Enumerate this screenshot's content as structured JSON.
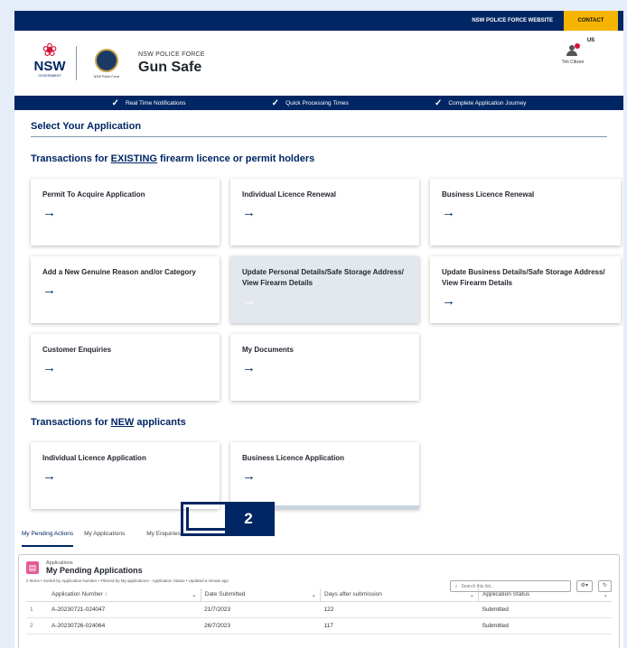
{
  "util_bar": {
    "website_link": "NSW POLICE FORCE WEBSITE",
    "contact": "CONTACT US"
  },
  "header": {
    "nsw_logo": {
      "word": "NSW",
      "sub": "GOVERNMENT"
    },
    "badge_label": "NSW Police Force",
    "org": "NSW POLICE FORCE",
    "app": "Gun Safe",
    "user_name": "Tim Citizen"
  },
  "features": [
    "Real Time Notifications",
    "Quick Processing Times",
    "Complete Application Journey"
  ],
  "page": {
    "title": "Select Your  Application",
    "existing": {
      "pre": "Transactions for ",
      "u": "EXISTING",
      "post": " firearm licence or permit holders"
    },
    "new": {
      "pre": "Transactions for ",
      "u": "NEW",
      "post": " applicants"
    }
  },
  "existing_cards": [
    "Permit To Acquire Application",
    "Individual Licence Renewal",
    "Business Licence Renewal",
    "Add a New Genuine Reason and/or Category",
    "Update Personal Details/Safe Storage Address/ View Firearm Details",
    "Update Business Details/Safe Storage Address/ View Firearm Details",
    "Customer Enquiries",
    "My Documents"
  ],
  "new_cards": [
    "Individual Licence Application",
    "Business Licence Application"
  ],
  "arrow": "→",
  "tabs": [
    "My Pending Actions",
    "My Applications",
    "My Enquiries"
  ],
  "callout_number": "2",
  "panel": {
    "sup": "Applications",
    "title": "My Pending Applications",
    "meta": "2 Items • Sorted by Application Number • Filtered by My applications - Application Status • Updated a minute ago",
    "search_placeholder": "Search this list...",
    "columns": [
      "Application Number ↑",
      "Date Submitted",
      "Days after submission",
      "Application Status"
    ],
    "rows": [
      [
        "1",
        "A-20230721-024047",
        "21/7/2023",
        "122",
        "Submitted"
      ],
      [
        "2",
        "A-20230726-024064",
        "26/7/2023",
        "117",
        "Submitted"
      ]
    ]
  },
  "colors": {
    "navy": "#002664",
    "accent_yellow": "#f5b400",
    "waratah_red": "#d7153a"
  }
}
